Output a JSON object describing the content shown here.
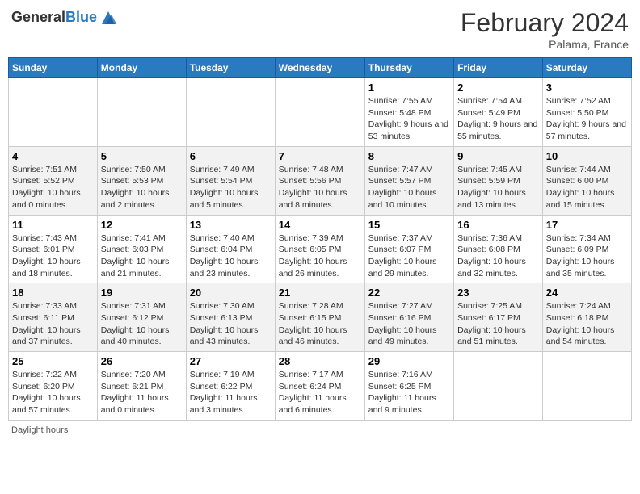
{
  "header": {
    "logo_general": "General",
    "logo_blue": "Blue",
    "month_title": "February 2024",
    "location": "Palama, France"
  },
  "days_of_week": [
    "Sunday",
    "Monday",
    "Tuesday",
    "Wednesday",
    "Thursday",
    "Friday",
    "Saturday"
  ],
  "weeks": [
    [
      {
        "day": "",
        "info": ""
      },
      {
        "day": "",
        "info": ""
      },
      {
        "day": "",
        "info": ""
      },
      {
        "day": "",
        "info": ""
      },
      {
        "day": "1",
        "info": "Sunrise: 7:55 AM\nSunset: 5:48 PM\nDaylight: 9 hours and 53 minutes."
      },
      {
        "day": "2",
        "info": "Sunrise: 7:54 AM\nSunset: 5:49 PM\nDaylight: 9 hours and 55 minutes."
      },
      {
        "day": "3",
        "info": "Sunrise: 7:52 AM\nSunset: 5:50 PM\nDaylight: 9 hours and 57 minutes."
      }
    ],
    [
      {
        "day": "4",
        "info": "Sunrise: 7:51 AM\nSunset: 5:52 PM\nDaylight: 10 hours and 0 minutes."
      },
      {
        "day": "5",
        "info": "Sunrise: 7:50 AM\nSunset: 5:53 PM\nDaylight: 10 hours and 2 minutes."
      },
      {
        "day": "6",
        "info": "Sunrise: 7:49 AM\nSunset: 5:54 PM\nDaylight: 10 hours and 5 minutes."
      },
      {
        "day": "7",
        "info": "Sunrise: 7:48 AM\nSunset: 5:56 PM\nDaylight: 10 hours and 8 minutes."
      },
      {
        "day": "8",
        "info": "Sunrise: 7:47 AM\nSunset: 5:57 PM\nDaylight: 10 hours and 10 minutes."
      },
      {
        "day": "9",
        "info": "Sunrise: 7:45 AM\nSunset: 5:59 PM\nDaylight: 10 hours and 13 minutes."
      },
      {
        "day": "10",
        "info": "Sunrise: 7:44 AM\nSunset: 6:00 PM\nDaylight: 10 hours and 15 minutes."
      }
    ],
    [
      {
        "day": "11",
        "info": "Sunrise: 7:43 AM\nSunset: 6:01 PM\nDaylight: 10 hours and 18 minutes."
      },
      {
        "day": "12",
        "info": "Sunrise: 7:41 AM\nSunset: 6:03 PM\nDaylight: 10 hours and 21 minutes."
      },
      {
        "day": "13",
        "info": "Sunrise: 7:40 AM\nSunset: 6:04 PM\nDaylight: 10 hours and 23 minutes."
      },
      {
        "day": "14",
        "info": "Sunrise: 7:39 AM\nSunset: 6:05 PM\nDaylight: 10 hours and 26 minutes."
      },
      {
        "day": "15",
        "info": "Sunrise: 7:37 AM\nSunset: 6:07 PM\nDaylight: 10 hours and 29 minutes."
      },
      {
        "day": "16",
        "info": "Sunrise: 7:36 AM\nSunset: 6:08 PM\nDaylight: 10 hours and 32 minutes."
      },
      {
        "day": "17",
        "info": "Sunrise: 7:34 AM\nSunset: 6:09 PM\nDaylight: 10 hours and 35 minutes."
      }
    ],
    [
      {
        "day": "18",
        "info": "Sunrise: 7:33 AM\nSunset: 6:11 PM\nDaylight: 10 hours and 37 minutes."
      },
      {
        "day": "19",
        "info": "Sunrise: 7:31 AM\nSunset: 6:12 PM\nDaylight: 10 hours and 40 minutes."
      },
      {
        "day": "20",
        "info": "Sunrise: 7:30 AM\nSunset: 6:13 PM\nDaylight: 10 hours and 43 minutes."
      },
      {
        "day": "21",
        "info": "Sunrise: 7:28 AM\nSunset: 6:15 PM\nDaylight: 10 hours and 46 minutes."
      },
      {
        "day": "22",
        "info": "Sunrise: 7:27 AM\nSunset: 6:16 PM\nDaylight: 10 hours and 49 minutes."
      },
      {
        "day": "23",
        "info": "Sunrise: 7:25 AM\nSunset: 6:17 PM\nDaylight: 10 hours and 51 minutes."
      },
      {
        "day": "24",
        "info": "Sunrise: 7:24 AM\nSunset: 6:18 PM\nDaylight: 10 hours and 54 minutes."
      }
    ],
    [
      {
        "day": "25",
        "info": "Sunrise: 7:22 AM\nSunset: 6:20 PM\nDaylight: 10 hours and 57 minutes."
      },
      {
        "day": "26",
        "info": "Sunrise: 7:20 AM\nSunset: 6:21 PM\nDaylight: 11 hours and 0 minutes."
      },
      {
        "day": "27",
        "info": "Sunrise: 7:19 AM\nSunset: 6:22 PM\nDaylight: 11 hours and 3 minutes."
      },
      {
        "day": "28",
        "info": "Sunrise: 7:17 AM\nSunset: 6:24 PM\nDaylight: 11 hours and 6 minutes."
      },
      {
        "day": "29",
        "info": "Sunrise: 7:16 AM\nSunset: 6:25 PM\nDaylight: 11 hours and 9 minutes."
      },
      {
        "day": "",
        "info": ""
      },
      {
        "day": "",
        "info": ""
      }
    ]
  ],
  "footer": {
    "daylight_label": "Daylight hours"
  }
}
